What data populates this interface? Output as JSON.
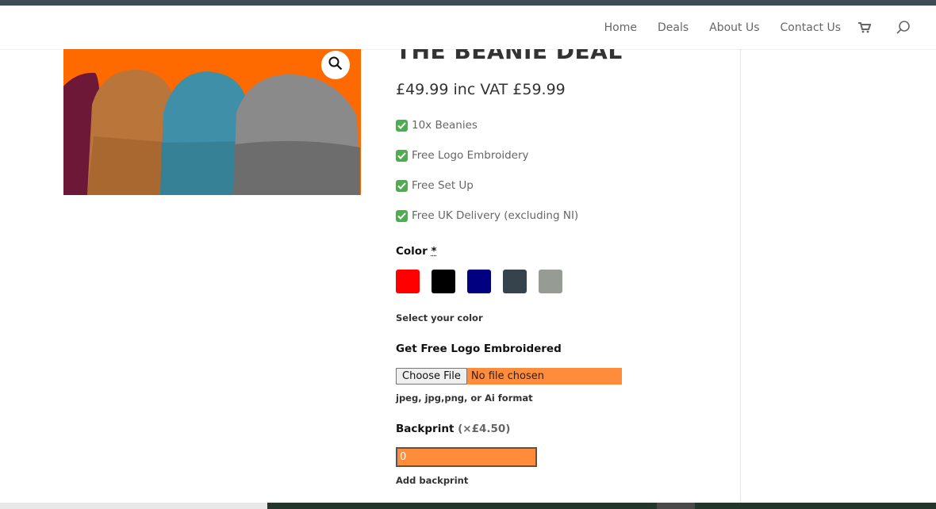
{
  "nav": {
    "items": [
      "Home",
      "Deals",
      "About Us",
      "Contact Us"
    ],
    "cart_icon": "cart-icon",
    "search_icon": "search-icon"
  },
  "product": {
    "title": "THE BEANIE DEAL",
    "price": "£49.99 inc VAT £59.99",
    "features": [
      "10x Beanies",
      "Free Logo Embroidery",
      "Free Set Up",
      "Free UK Delivery (excluding NI)"
    ],
    "image_colors": [
      "#6e1838",
      "#b9753a",
      "#3f8fa8",
      "#8a8a8a"
    ],
    "image_background": "#ff6a00"
  },
  "color_field": {
    "label": "Color",
    "required_mark": "*",
    "swatches": [
      "#ff0000",
      "#000000",
      "#000080",
      "#36434d",
      "#969c93"
    ],
    "hint": "Select your color"
  },
  "logo_field": {
    "label": "Get Free Logo Embroidered",
    "button_label": "Choose File",
    "status": "No file chosen",
    "hint": "jpeg, jpg,png, or Ai format"
  },
  "backprint_field": {
    "label": "Backprint",
    "price": "(×£4.50)",
    "value": "0",
    "hint": "Add backprint"
  },
  "colors": {
    "accent_orange": "#ff8c3a",
    "topbar": "#3f4b53",
    "check_green": "#4cae4f"
  }
}
